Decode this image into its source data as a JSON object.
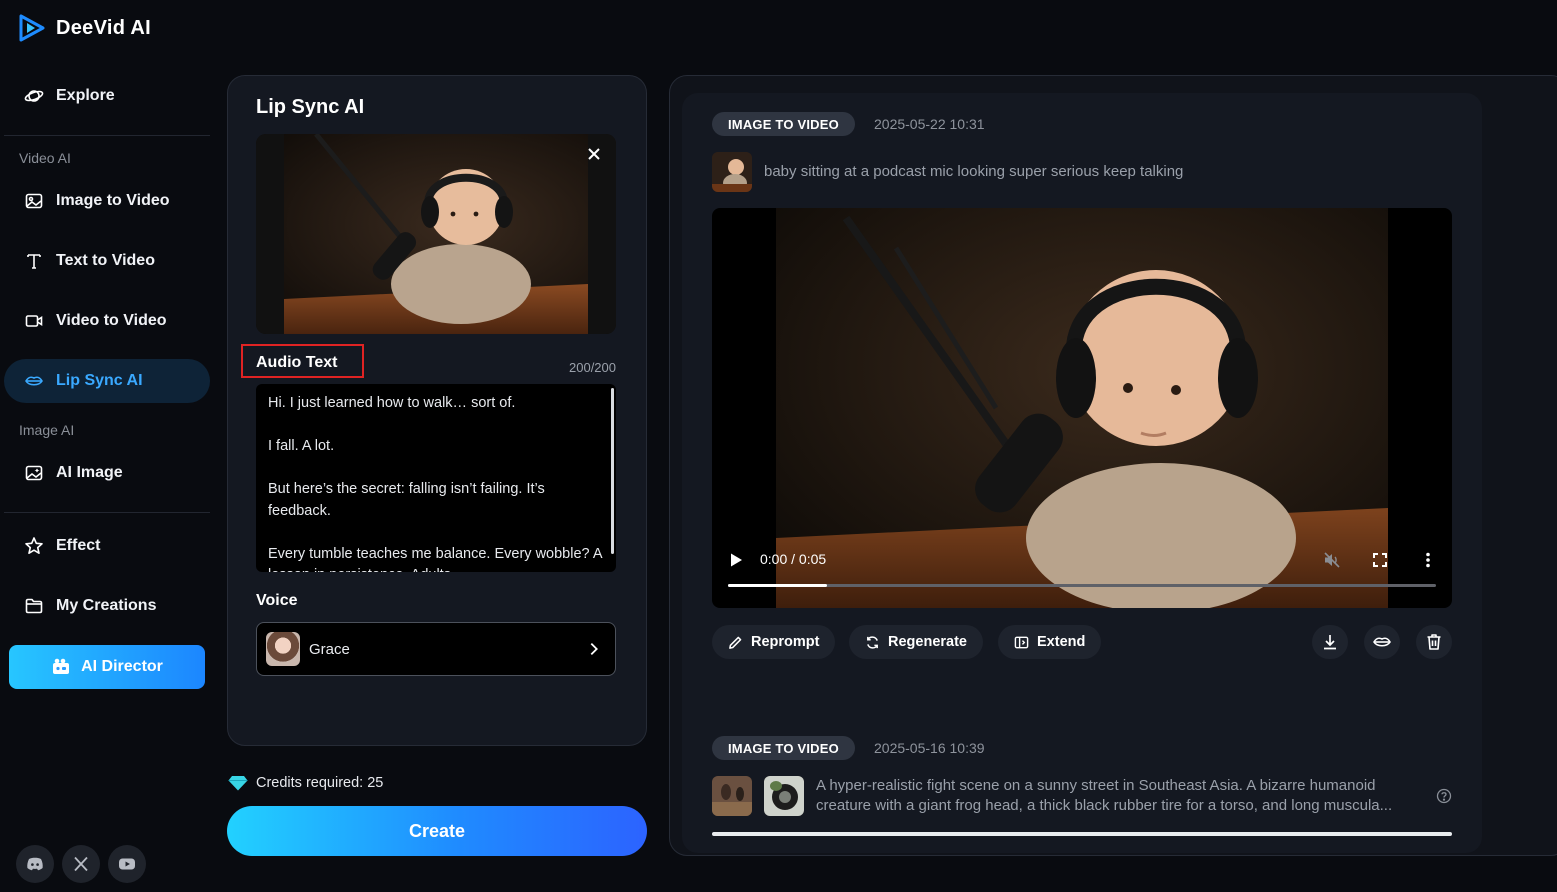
{
  "app": {
    "name": "DeeVid AI"
  },
  "sidebar": {
    "explore": "Explore",
    "section_video": "Video AI",
    "image_to_video": "Image to Video",
    "text_to_video": "Text to Video",
    "video_to_video": "Video to Video",
    "lip_sync": "Lip Sync AI",
    "section_image": "Image AI",
    "ai_image": "AI Image",
    "effect": "Effect",
    "my_creations": "My Creations",
    "ai_director": "AI Director",
    "social": [
      "discord-icon",
      "x-icon",
      "youtube-icon"
    ]
  },
  "panel": {
    "title": "Lip Sync AI",
    "audio_label": "Audio Text",
    "counter": "200/200",
    "audio_text": [
      "Hi. I just learned how to walk… sort of.",
      "I fall. A lot.",
      "But here’s the secret: falling isn’t failing. It’s feedback.",
      "Every tumble teaches me balance. Every wobble? A lesson in persistence. Adults"
    ],
    "voice_label": "Voice",
    "voice_name": "Grace"
  },
  "credits": "Credits required: 25",
  "create": "Create",
  "creations": [
    {
      "badge": "IMAGE TO VIDEO",
      "date": "2025-05-22 10:31",
      "prompt": "baby sitting at a podcast mic looking super serious keep talking",
      "time": "0:00 / 0:05",
      "progress": 0.14,
      "actions": [
        "Reprompt",
        "Regenerate",
        "Extend"
      ]
    },
    {
      "badge": "IMAGE TO VIDEO",
      "date": "2025-05-16 10:39",
      "prompt_line1": "A hyper-realistic fight scene on a sunny street in Southeast Asia. A bizarre humanoid",
      "prompt_line2": "creature with a giant frog head, a thick black rubber tire for a torso, and long muscula..."
    }
  ],
  "colors": {
    "accent": "#1f8bff",
    "active_nav_bg": "#0e2337",
    "highlight_box": "#e02323"
  }
}
